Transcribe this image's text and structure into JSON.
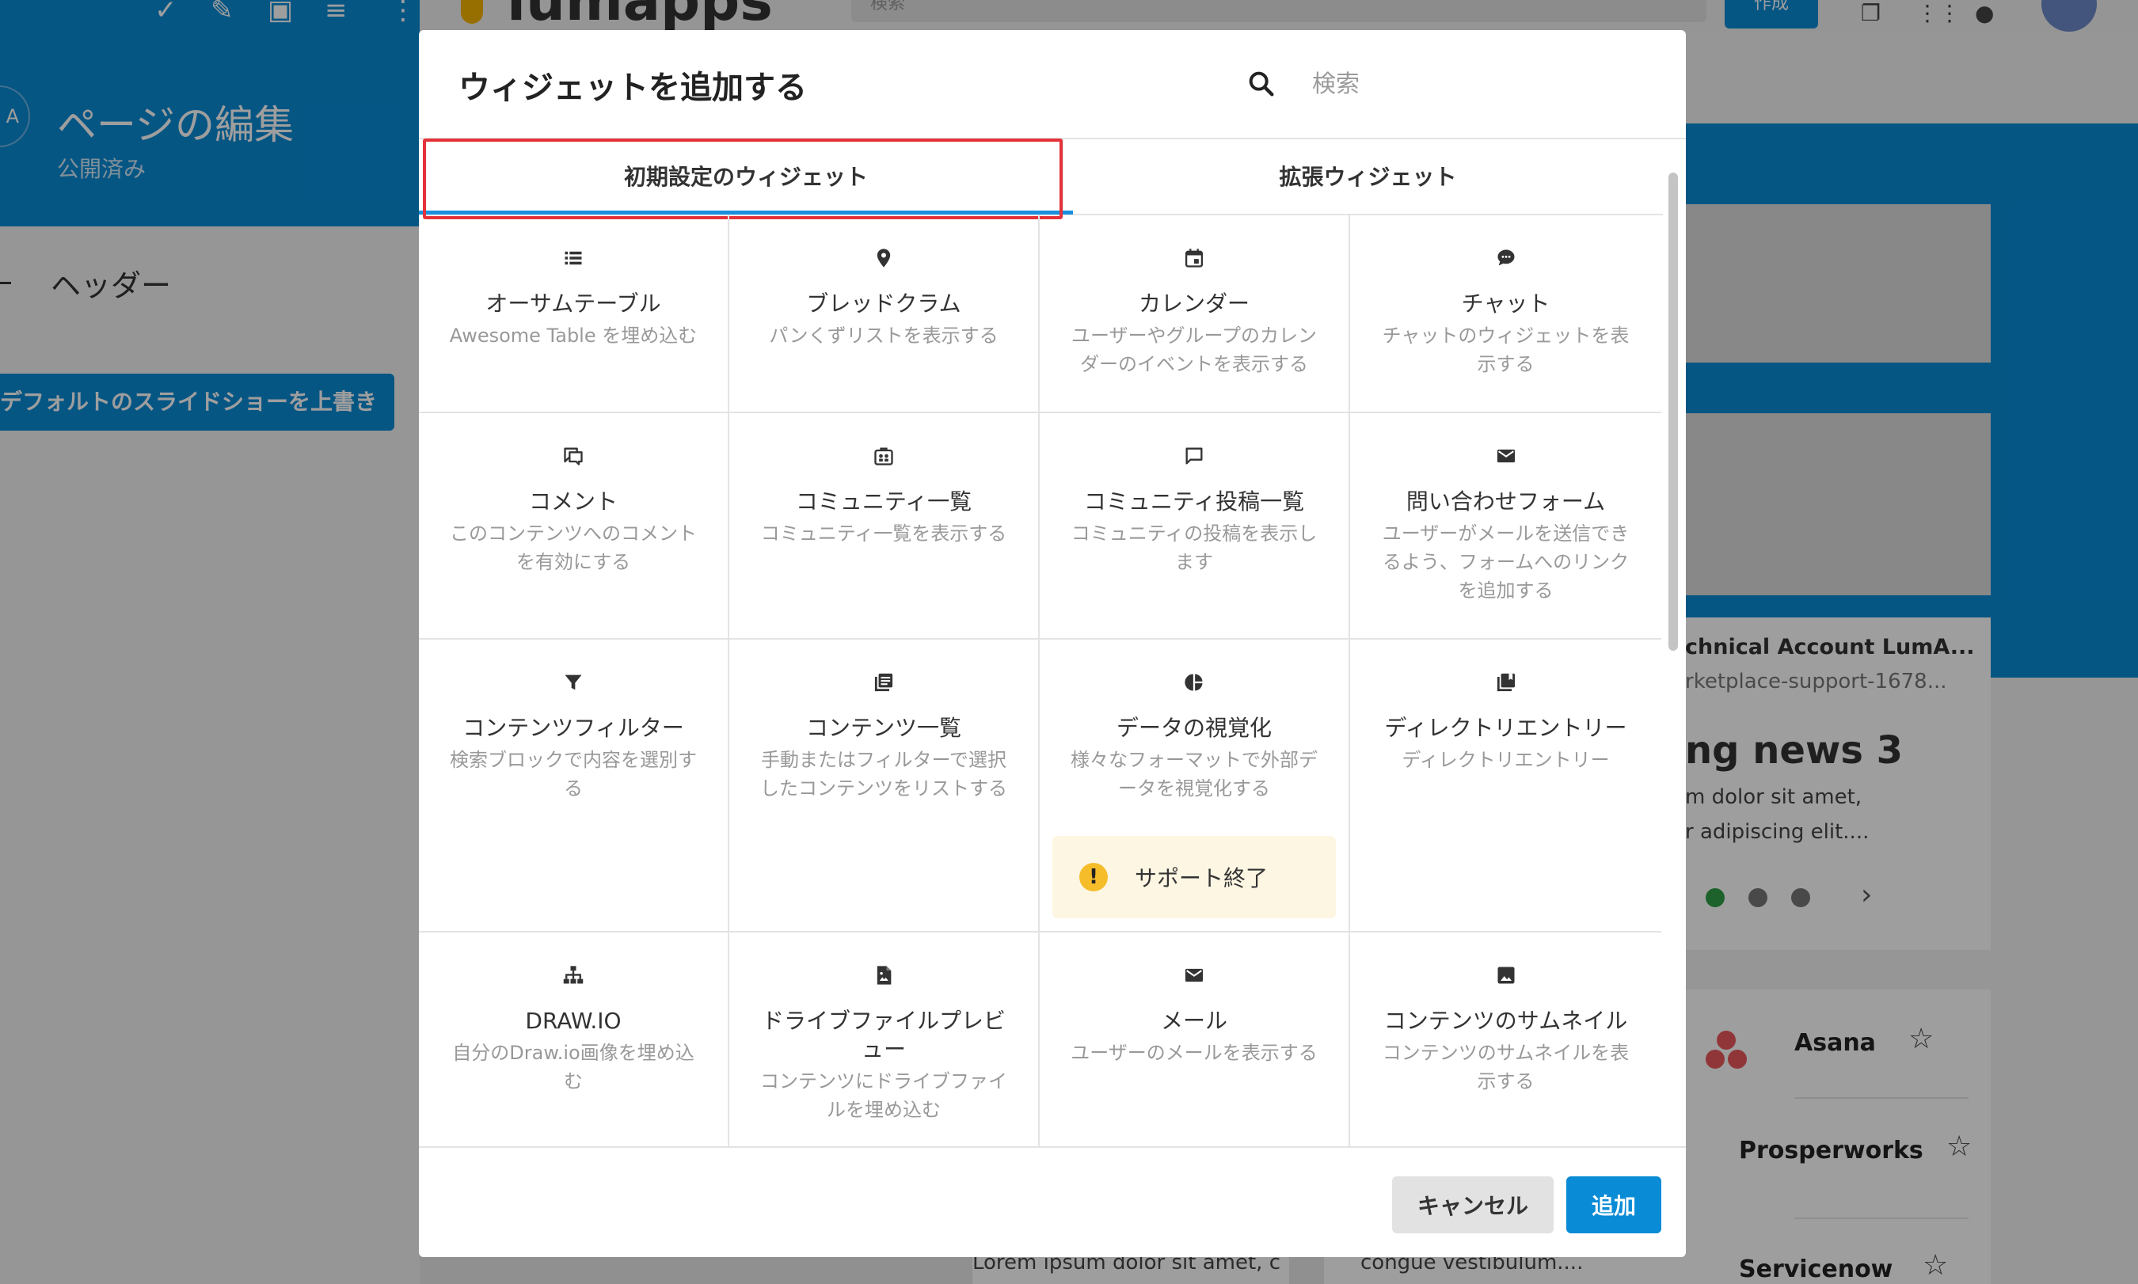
{
  "background": {
    "top_search_placeholder": "検索",
    "create_label": "作成",
    "brand": "lumapps",
    "page_avatar": "A",
    "page_title": "ページの編集",
    "page_status": "公開済み",
    "header_label": "ヘッダー",
    "slideshow_button": "デフォルトのスライドショーを上書き",
    "news_card": {
      "account": "chnical Account LumA...",
      "account_sub": "rketplace-support-1678...",
      "headline": "ng news 3",
      "body_line1": "m dolor sit amet,",
      "body_line2": "r adipiscing elit...."
    },
    "apps": [
      {
        "name": "Asana"
      },
      {
        "name": "Prosperworks"
      },
      {
        "name": "Servicenow"
      }
    ],
    "bottom_text1": "Lorem ipsum dolor sit amet, c",
    "bottom_text2": "congue vestibulum...."
  },
  "modal": {
    "title": "ウィジェットを追加する",
    "search_placeholder": "検索",
    "tabs": [
      {
        "label": "初期設定のウィジェット",
        "active": true
      },
      {
        "label": "拡張ウィジェット",
        "active": false
      }
    ],
    "widgets": [
      {
        "icon": "table-icon",
        "title": "オーサムテーブル",
        "desc": "Awesome Table を埋め込む"
      },
      {
        "icon": "location-pin-icon",
        "title": "ブレッドクラム",
        "desc": "パンくずリストを表示する"
      },
      {
        "icon": "calendar-icon",
        "title": "カレンダー",
        "desc": "ユーザーやグループのカレンダーのイベントを表示する"
      },
      {
        "icon": "chat-bubble-icon",
        "title": "チャット",
        "desc": "チャットのウィジェットを表示する"
      },
      {
        "icon": "comments-icon",
        "title": "コメント",
        "desc": "このコンテンツへのコメントを有効にする"
      },
      {
        "icon": "community-list-icon",
        "title": "コミュニティ一覧",
        "desc": "コミュニティ一覧を表示する"
      },
      {
        "icon": "message-outline-icon",
        "title": "コミュニティ投稿一覧",
        "desc": "コミュニティの投稿を表示します"
      },
      {
        "icon": "envelope-icon",
        "title": "問い合わせフォーム",
        "desc": "ユーザーがメールを送信できるよう、フォームへのリンクを追加する"
      },
      {
        "icon": "filter-icon",
        "title": "コンテンツフィルター",
        "desc": "検索ブロックで内容を選別する"
      },
      {
        "icon": "content-list-icon",
        "title": "コンテンツ一覧",
        "desc": "手動またはフィルターで選択したコンテンツをリストする"
      },
      {
        "icon": "pie-chart-icon",
        "title": "データの視覚化",
        "desc": "様々なフォーマットで外部データを視覚化する",
        "badge": "サポート終了"
      },
      {
        "icon": "directory-icon",
        "title": "ディレクトリエントリー",
        "desc": "ディレクトリエントリー"
      },
      {
        "icon": "sitemap-icon",
        "title": "DRAW.IO",
        "desc": "自分のDraw.io画像を埋め込む"
      },
      {
        "icon": "file-image-icon",
        "title": "ドライブファイルプレビュー",
        "desc": "コンテンツにドライブファイルを埋め込む"
      },
      {
        "icon": "envelope-icon",
        "title": "メール",
        "desc": "ユーザーのメールを表示する"
      },
      {
        "icon": "image-icon",
        "title": "コンテンツのサムネイル",
        "desc": "コンテンツのサムネイルを表示する"
      }
    ],
    "cancel_label": "キャンセル",
    "add_label": "追加"
  },
  "colors": {
    "primary": "#0a8bd6",
    "highlight": "#e5323a",
    "warning": "#f6bd2a"
  }
}
